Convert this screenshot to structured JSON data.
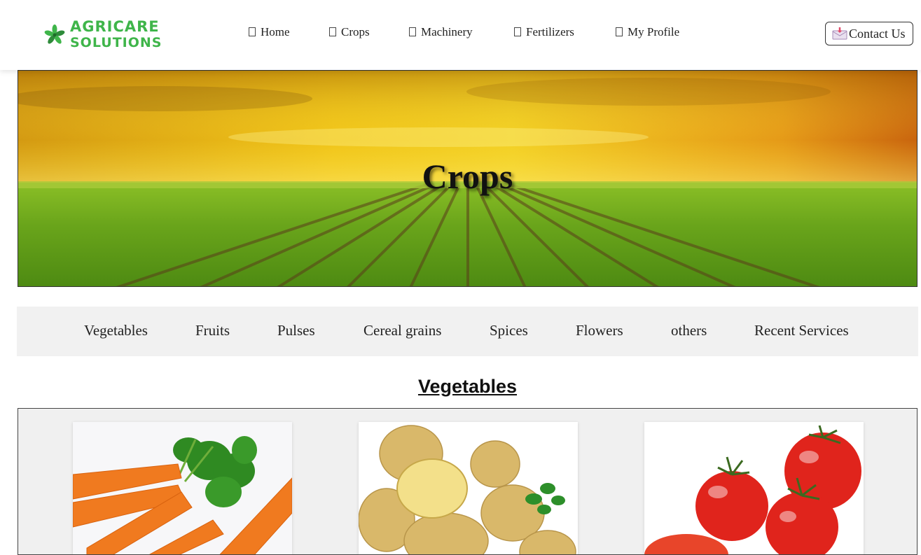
{
  "header": {
    "logo": {
      "line1": "AGRICARE",
      "line2": "SOLUTIONS",
      "icon": "leaf-pinwheel-icon"
    },
    "nav": [
      {
        "label": "Home",
        "icon": "home-icon"
      },
      {
        "label": "Crops",
        "icon": "crops-icon"
      },
      {
        "label": "Machinery",
        "icon": "machinery-icon"
      },
      {
        "label": "Fertilizers",
        "icon": "fertilizers-icon"
      },
      {
        "label": "My Profile",
        "icon": "user-icon"
      }
    ],
    "contact": {
      "label": "Contact Us",
      "icon": "envelope-icon"
    }
  },
  "hero": {
    "title": "Crops"
  },
  "categories": [
    "Vegetables",
    "Fruits",
    "Pulses",
    "Cereal grains",
    "Spices",
    "Flowers",
    "others",
    "Recent Services"
  ],
  "section": {
    "title": "Vegetables",
    "cards": [
      {
        "image": "carrots"
      },
      {
        "image": "potatoes"
      },
      {
        "image": "tomatoes"
      }
    ]
  },
  "colors": {
    "brand_green": "#3fb54a",
    "category_bar": "#f1f1f1"
  }
}
